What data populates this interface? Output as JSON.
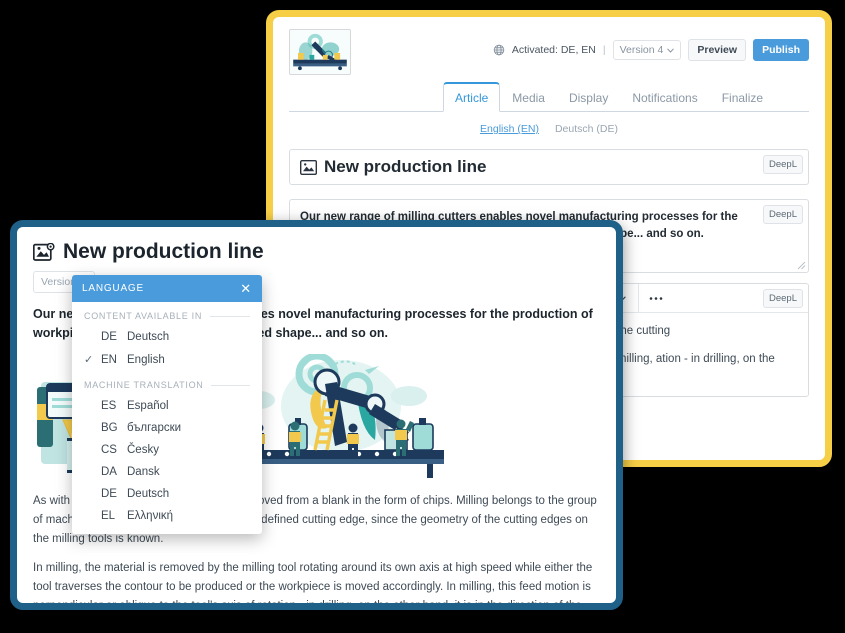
{
  "colors": {
    "back_panel_border": "#F7CF46",
    "front_panel_border": "#1F6088",
    "accent_blue": "#4A9BDB",
    "tab_active": "#3498db",
    "background": "#000000"
  },
  "back_panel": {
    "thumbnail_icon": "robot-production-line-illustration",
    "header": {
      "globe_icon": "globe-icon",
      "activated_label": "Activated: DE, EN",
      "separator": "|",
      "version_label": "Version 4",
      "version_caret_icon": "chevron-down-icon",
      "preview_label": "Preview",
      "publish_label": "Publish"
    },
    "tabs": [
      {
        "label": "Article",
        "active": true
      },
      {
        "label": "Media",
        "active": false
      },
      {
        "label": "Display",
        "active": false
      },
      {
        "label": "Notifications",
        "active": false
      },
      {
        "label": "Finalize",
        "active": false
      }
    ],
    "language_tabs": [
      {
        "label": "English (EN)",
        "active": true
      },
      {
        "label": "Deutsch (DE)",
        "active": false
      }
    ],
    "title_field": {
      "icon": "image-icon",
      "value": "New production line",
      "deepl_label": "DeepL"
    },
    "teaser_field": {
      "value": "Our new range of milling cutters enables novel manufacturing processes for the production of workpieces with a geometrically defined shape... and so on.",
      "deepl_label": "DeepL"
    },
    "editor": {
      "deepl_label": "DeepL",
      "toolbar_icons": [
        "chevron-down-icon",
        "ordered-list-icon",
        "outdent-icon",
        "indent-icon",
        "spellcheck-icon",
        "chevron-down-icon",
        "more-options-icon"
      ],
      "paragraphs": [
        "n the form of chips. Milling belongs lge, since the geometry of the cutting",
        "d its own axis at high speed while ce is moved accordingly. In milling, ation - in drilling, on the other hand, ieces rotate about their own axis"
      ]
    }
  },
  "front_panel": {
    "title": {
      "icon": "image-settings-icon",
      "text": "New production line"
    },
    "version_button": {
      "label": "Version",
      "caret_icon": "chevron-down-icon"
    },
    "lead_paragraph": "Our new range of milling cutters enables novel manufacturing processes for the production of workpieces with a geometrically defined shape... and so on.",
    "images": [
      "online-store-illustration",
      "robot-arm-production-line-illustration"
    ],
    "body_paragraphs": [
      "As with all milling processes, material is removed from a blank in the form of chips. Milling belongs to the group of machining processes with a geometrically defined cutting edge, since the geometry of the cutting edges on the milling tools is known.",
      "In milling, the material is removed by the milling tool rotating around its own axis at high speed while either the tool traverses the contour to be produced or the workpiece is moved accordingly. In milling, this feed motion is perpendicular or oblique to the tool's axis of rotation - in drilling, on the other hand, it is in the direction of the axis of rotation, and in turning, the workpieces rotate about their own axis while the tool traverses the contour."
    ]
  },
  "language_popup": {
    "header_title": "LANGUAGE",
    "close_icon": "close-icon",
    "groups": [
      {
        "title": "CONTENT AVAILABLE IN",
        "items": [
          {
            "code": "DE",
            "name": "Deutsch",
            "selected": false
          },
          {
            "code": "EN",
            "name": "English",
            "selected": true
          }
        ]
      },
      {
        "title": "MACHINE TRANSLATION",
        "items": [
          {
            "code": "ES",
            "name": "Español",
            "selected": false
          },
          {
            "code": "BG",
            "name": "български",
            "selected": false
          },
          {
            "code": "CS",
            "name": "Česky",
            "selected": false
          },
          {
            "code": "DA",
            "name": "Dansk",
            "selected": false
          },
          {
            "code": "DE",
            "name": "Deutsch",
            "selected": false
          },
          {
            "code": "EL",
            "name": "Ελληνική",
            "selected": false
          }
        ]
      }
    ]
  }
}
